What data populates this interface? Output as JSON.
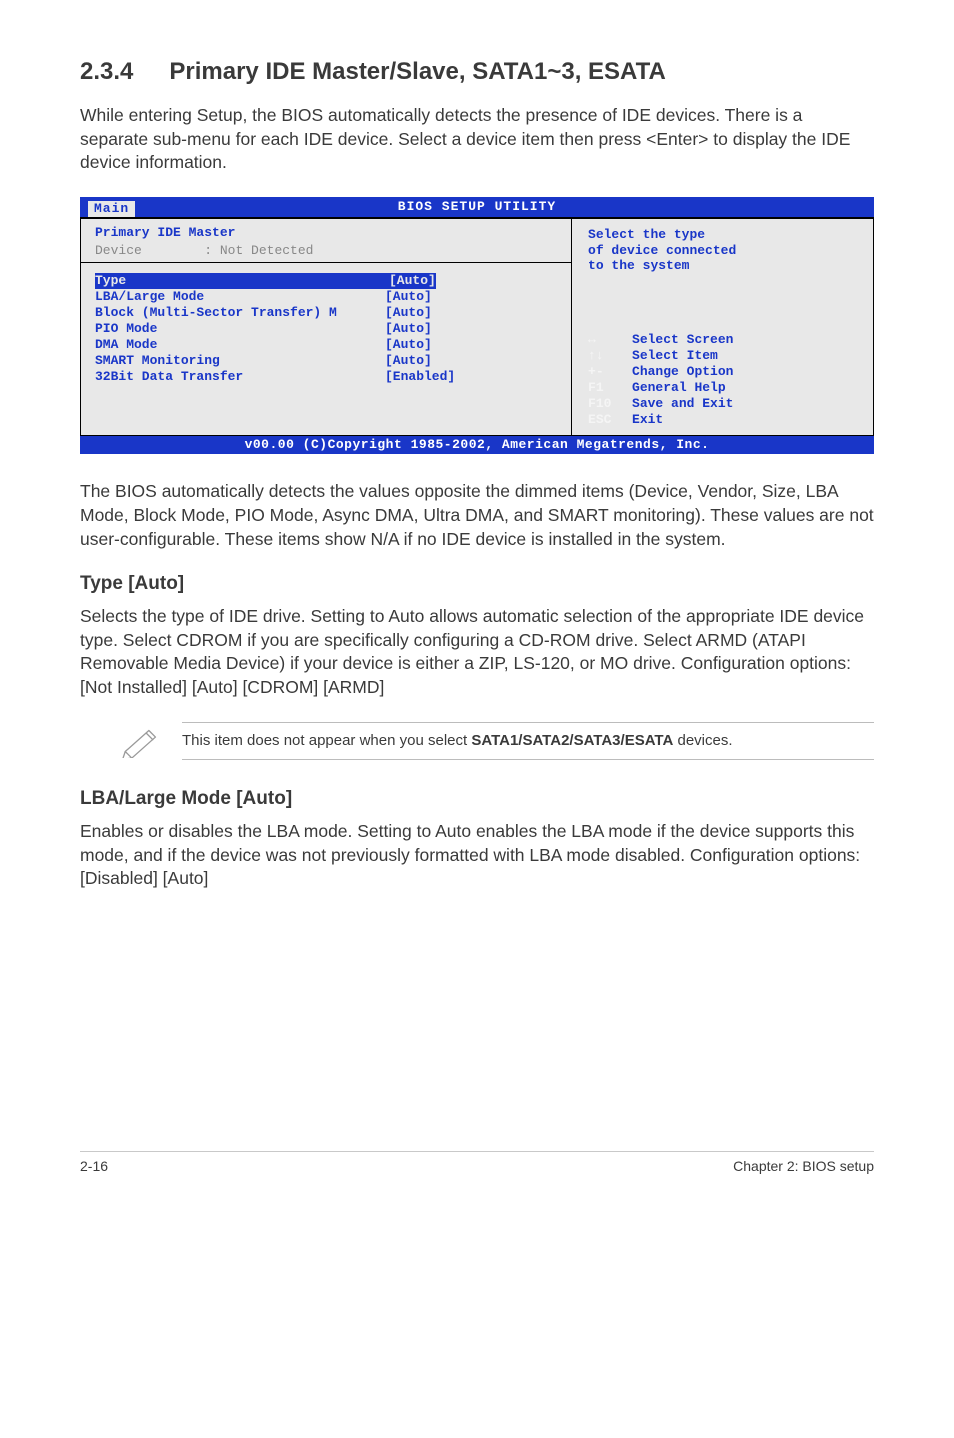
{
  "heading": {
    "num": "2.3.4",
    "title": "Primary IDE Master/Slave, SATA1~3, ESATA"
  },
  "intro": "While entering Setup, the BIOS automatically detects the presence of IDE devices. There is a separate sub-menu for each IDE device. Select a device item then press <Enter> to display the IDE device information.",
  "bios": {
    "utility_title": "BIOS SETUP UTILITY",
    "tab": "Main",
    "header_title": "Primary IDE Master",
    "device_label": "Device",
    "device_value": ": Not Detected",
    "rows": [
      {
        "label": "Type",
        "value": "[Auto]",
        "selected": true
      },
      {
        "label": "LBA/Large Mode",
        "value": "[Auto]",
        "selected": false
      },
      {
        "label": "Block (Multi-Sector Transfer) M",
        "value": "[Auto]",
        "selected": false
      },
      {
        "label": "PIO Mode",
        "value": "[Auto]",
        "selected": false
      },
      {
        "label": "DMA Mode",
        "value": "[Auto]",
        "selected": false
      },
      {
        "label": "SMART Monitoring",
        "value": "[Auto]",
        "selected": false
      },
      {
        "label": "32Bit Data Transfer",
        "value": "[Enabled]",
        "selected": false
      }
    ],
    "help": {
      "line1": "Select the type",
      "line2": "of device connected",
      "line3": "to the system"
    },
    "keys": [
      {
        "k": "↔",
        "d": "Select Screen"
      },
      {
        "k": "↑↓",
        "d": "Select Item"
      },
      {
        "k": "+-",
        "d": "Change Option"
      },
      {
        "k": "F1",
        "d": "General Help"
      },
      {
        "k": "F10",
        "d": "Save and Exit"
      },
      {
        "k": "ESC",
        "d": "Exit"
      }
    ],
    "footer": "v00.00 (C)Copyright 1985-2002, American Megatrends, Inc."
  },
  "after_bios": "The BIOS automatically detects the values opposite the dimmed items (Device, Vendor, Size, LBA Mode, Block Mode, PIO Mode, Async DMA, Ultra DMA, and SMART monitoring). These values are not user-configurable. These items show N/A if no IDE device is installed in the system.",
  "sec_type": {
    "title": "Type [Auto]",
    "body": "Selects the type of IDE drive. Setting to Auto allows automatic selection of the appropriate IDE device type. Select CDROM if you are specifically configuring a CD-ROM drive. Select ARMD (ATAPI Removable Media Device) if your device is either a ZIP, LS-120, or MO drive. Configuration options: [Not Installed] [Auto] [CDROM] [ARMD]"
  },
  "note": {
    "prefix": "This item does not appear when you select ",
    "bold": "SATA1/SATA2/SATA3/ESATA",
    "suffix": " devices."
  },
  "sec_lba": {
    "title": "LBA/Large Mode [Auto]",
    "body": "Enables or disables the LBA mode. Setting to Auto enables the LBA mode if the device supports this mode, and if the device was not previously formatted with LBA mode disabled. Configuration options: [Disabled] [Auto]"
  },
  "page_footer": {
    "left": "2-16",
    "right": "Chapter 2: BIOS setup"
  }
}
